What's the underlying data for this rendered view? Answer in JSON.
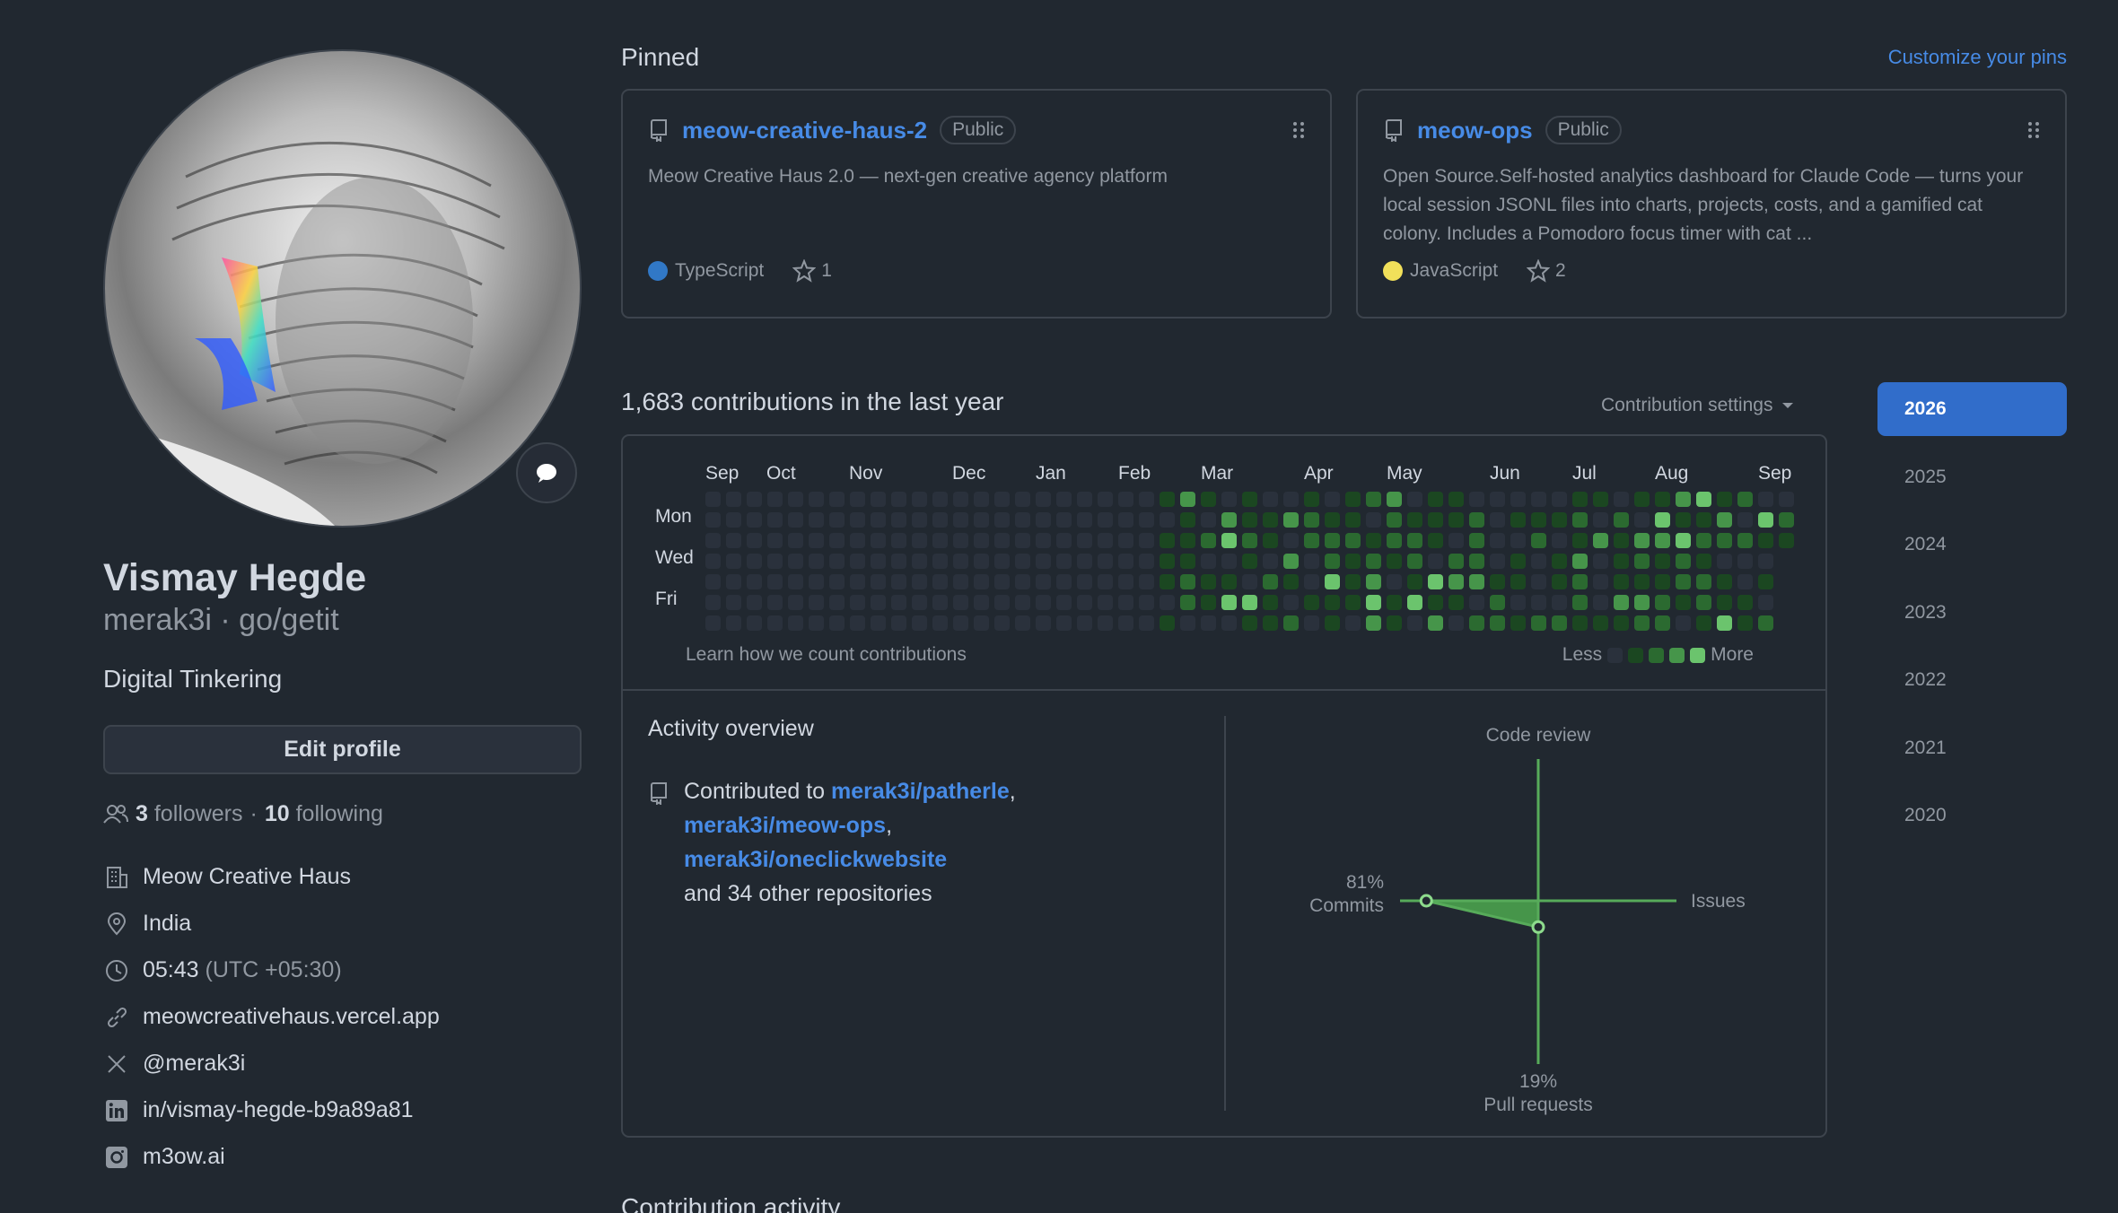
{
  "profile": {
    "name": "Vismay Hegde",
    "handle": "merak3i",
    "handle_sep": " · ",
    "pronouns": "go/getit",
    "bio": "Digital Tinkering",
    "edit_label": "Edit profile",
    "followers_count": "3",
    "followers_label": "followers",
    "sep": "·",
    "following_count": "10",
    "following_label": "following",
    "details": [
      {
        "icon": "building-icon",
        "text": "Meow Creative Haus"
      },
      {
        "icon": "location-icon",
        "text": "India"
      },
      {
        "icon": "clock-icon",
        "text": "05:43",
        "muted": "(UTC +05:30)"
      },
      {
        "icon": "link-icon",
        "text": "meowcreativehaus.vercel.app"
      },
      {
        "icon": "x-icon",
        "text": "@merak3i"
      },
      {
        "icon": "linkedin-icon",
        "text": "in/vismay-hegde-b9a89a81"
      },
      {
        "icon": "instagram-icon",
        "text": "m3ow.ai"
      }
    ]
  },
  "pinned": {
    "title": "Pinned",
    "customize": "Customize your pins",
    "repos": [
      {
        "name": "meow-creative-haus-2",
        "visibility": "Public",
        "description": "Meow Creative Haus 2.0 — next-gen creative agency platform",
        "language": "TypeScript",
        "language_color": "#3178c6",
        "stars": "1"
      },
      {
        "name": "meow-ops",
        "visibility": "Public",
        "description": "Open Source.Self-hosted analytics dashboard for Claude Code — turns your local session JSONL files into charts, projects, costs, and a gamified cat colony. Includes a Pomodoro focus timer with cat ...",
        "language": "JavaScript",
        "language_color": "#f1e05a",
        "stars": "2"
      }
    ]
  },
  "contributions": {
    "title": "1,683 contributions in the last year",
    "settings": "Contribution settings",
    "months": [
      "Sep",
      "Oct",
      "Nov",
      "Dec",
      "Jan",
      "Feb",
      "Mar",
      "Apr",
      "May",
      "Jun",
      "Jul",
      "Aug",
      "Sep"
    ],
    "days": [
      "Mon",
      "Wed",
      "Fri"
    ],
    "learn": "Learn how we count contributions",
    "less": "Less",
    "more": "More",
    "level_colors": [
      "#2a313c",
      "#1b4721",
      "#2b6a30",
      "#46954a",
      "#6bc46d"
    ]
  },
  "activity": {
    "title": "Activity overview",
    "contributed_prefix": "Contributed to ",
    "repos": [
      "merak3i/patherle",
      "merak3i/meow-ops",
      "merak3i/oneclickwebsite"
    ],
    "suffix": "and 34 other repositories",
    "radar": {
      "code_review": "Code review",
      "issues": "Issues",
      "commits_pct": "81%",
      "commits": "Commits",
      "pr_pct": "19%",
      "pull_requests": "Pull requests",
      "commits_value": 81,
      "pr_value": 19
    }
  },
  "contribution_activity": "Contribution activity",
  "years": [
    "2026",
    "2025",
    "2024",
    "2023",
    "2022",
    "2021",
    "2020"
  ],
  "active_year": "2026"
}
